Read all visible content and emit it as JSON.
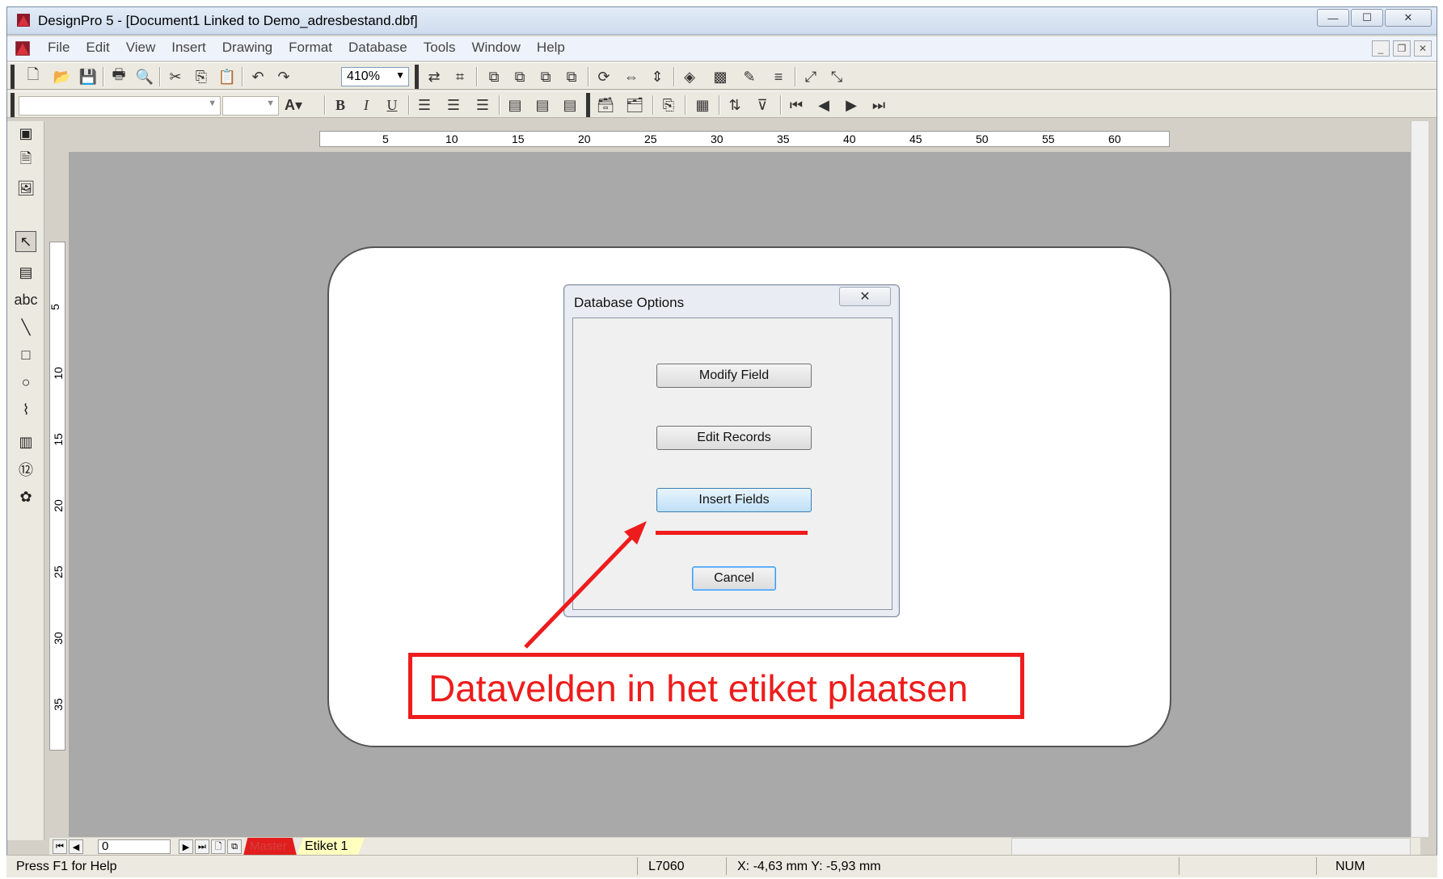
{
  "window": {
    "title": "DesignPro 5 - [Document1 Linked to Demo_adresbestand.dbf]",
    "controls": {
      "minimize": "—",
      "maximize": "☐",
      "close": "✕"
    }
  },
  "menubar": {
    "items": [
      "File",
      "Edit",
      "View",
      "Insert",
      "Drawing",
      "Format",
      "Database",
      "Tools",
      "Window",
      "Help"
    ],
    "mdi_controls": {
      "minimize": "_",
      "restore": "❐",
      "close": "✕"
    }
  },
  "toolbar": {
    "zoom_value": "410%"
  },
  "ruler": {
    "horizontal": [
      "5",
      "10",
      "15",
      "20",
      "25",
      "30",
      "35",
      "40",
      "45",
      "50",
      "55",
      "60"
    ],
    "vertical": [
      "5",
      "10",
      "15",
      "20",
      "25",
      "30",
      "35"
    ]
  },
  "dialog": {
    "title": "Database Options",
    "close": "✕",
    "buttons": {
      "modify_field": "Modify Field",
      "edit_records": "Edit Records",
      "insert_fields": "Insert Fields",
      "cancel": "Cancel"
    }
  },
  "annotation": {
    "text": "Datavelden in het etiket plaatsen",
    "color": "#ee1c1c"
  },
  "navigator": {
    "page": "0",
    "tabs": {
      "master": "Master",
      "etiket": "Etiket 1"
    }
  },
  "statusbar": {
    "help": "Press F1 for Help",
    "label_type": "L7060",
    "coords": "X: -4,63 mm  Y: -5,93 mm",
    "num": "NUM"
  }
}
